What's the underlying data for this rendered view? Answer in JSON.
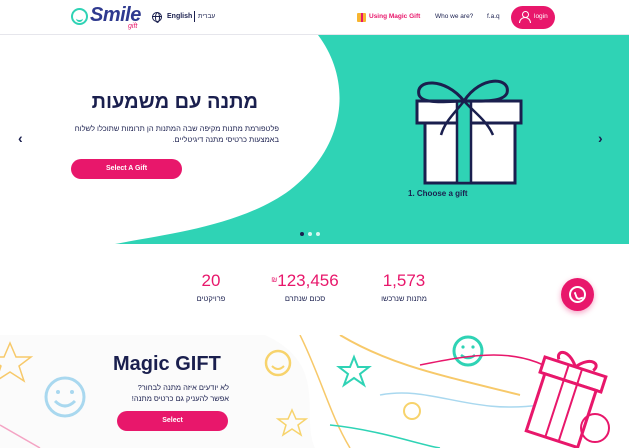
{
  "header": {
    "logo_text": "Smile",
    "logo_sub": "gift",
    "lang_en": "English",
    "lang_he": "עברית",
    "nav_magic": "Using Magic Gift",
    "nav_who": "Who we are?",
    "nav_faq": "f.a.q",
    "login": "login"
  },
  "hero": {
    "title": "מתנה עם משמעות",
    "description": "פלטפורמת מתנות מקיפה שבה המתנות הן תרומות שתוכלו לשלוח באמצעות כרטיסי מתנה דיגיטליים.",
    "button": "Select A Gift",
    "step": "1. Choose a gift",
    "prev_arrow": "‹",
    "next_arrow": "›"
  },
  "stats": [
    {
      "value": "1,573",
      "label": "מתנות שנרכשו"
    },
    {
      "value": "123,456",
      "currency": "₪",
      "label": "סכום שנתרם"
    },
    {
      "value": "20",
      "label": "פרויקטים"
    }
  ],
  "magic": {
    "title": "Magic GIFT",
    "line1": "לא יודעים איזה מתנה לבחור?",
    "line2": "אפשר להעניק גם כרטיס מתנה!",
    "button": "Select"
  },
  "colors": {
    "accent": "#e8176b",
    "teal": "#2fd3b5",
    "navy": "#1a1f4e"
  }
}
